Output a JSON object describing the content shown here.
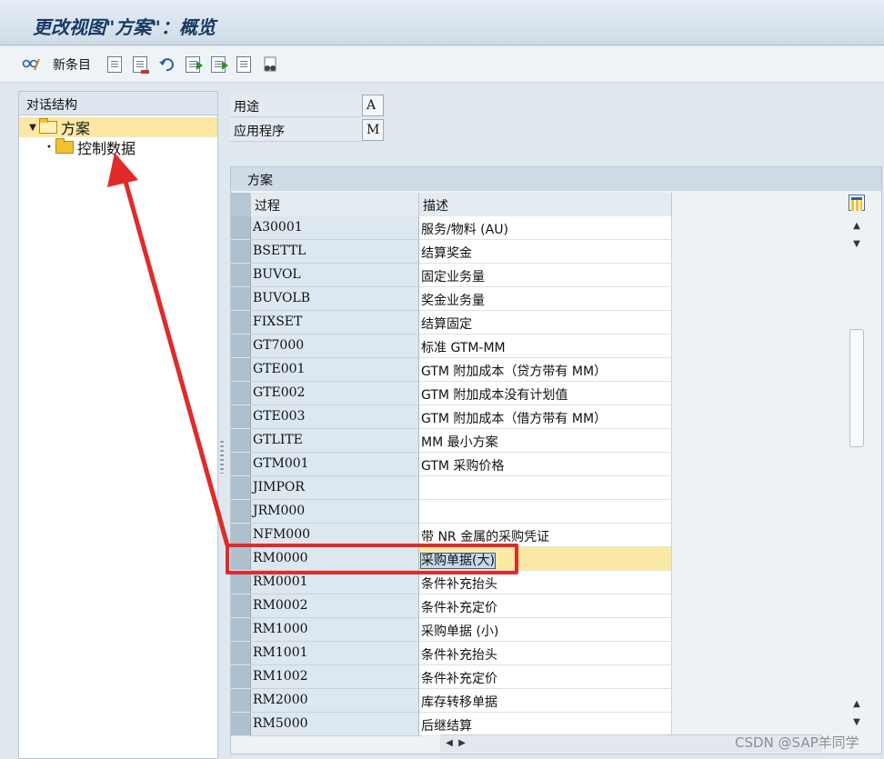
{
  "window": {
    "title": "更改视图\"方案\"：概览"
  },
  "toolbar": {
    "new_entries_label": "新条目"
  },
  "dialog_structure": {
    "header": "对话结构",
    "items": [
      {
        "label": "方案",
        "selected": true,
        "expanded": true
      },
      {
        "label": "控制数据",
        "selected": false
      }
    ]
  },
  "fields": {
    "usage_label": "用途",
    "usage_value": "A",
    "application_label": "应用程序",
    "application_value": "M"
  },
  "table": {
    "title": "方案",
    "columns": [
      "过程",
      "描述"
    ],
    "rows": [
      {
        "process": "A30001",
        "description": "服务/物料 (AU)"
      },
      {
        "process": "BSETTL",
        "description": "结算奖金"
      },
      {
        "process": "BUVOL",
        "description": "固定业务量"
      },
      {
        "process": "BUVOLB",
        "description": "奖金业务量"
      },
      {
        "process": "FIXSET",
        "description": "结算固定"
      },
      {
        "process": "GT7000",
        "description": "标准 GTM-MM"
      },
      {
        "process": "GTE001",
        "description": "GTM 附加成本（贷方带有 MM）"
      },
      {
        "process": "GTE002",
        "description": "GTM 附加成本没有计划值"
      },
      {
        "process": "GTE003",
        "description": "GTM 附加成本（借方带有 MM）"
      },
      {
        "process": "GTLITE",
        "description": "MM 最小方案"
      },
      {
        "process": "GTM001",
        "description": "GTM 采购价格"
      },
      {
        "process": "JIMPOR",
        "description": ""
      },
      {
        "process": "JRM000",
        "description": ""
      },
      {
        "process": "NFM000",
        "description": "带 NR 金属的采购凭证"
      },
      {
        "process": "RM0000",
        "description": "采购单据(大)",
        "focused": true
      },
      {
        "process": "RM0001",
        "description": "条件补充抬头"
      },
      {
        "process": "RM0002",
        "description": "条件补充定价"
      },
      {
        "process": "RM1000",
        "description": "采购单据 (小)"
      },
      {
        "process": "RM1001",
        "description": "条件补充抬头"
      },
      {
        "process": "RM1002",
        "description": "条件补充定价"
      },
      {
        "process": "RM2000",
        "description": "库存转移单据"
      },
      {
        "process": "RM5000",
        "description": "后继结算"
      }
    ]
  },
  "annotation_color": "#e12a2a",
  "watermark": "CSDN @SAP羊同学"
}
